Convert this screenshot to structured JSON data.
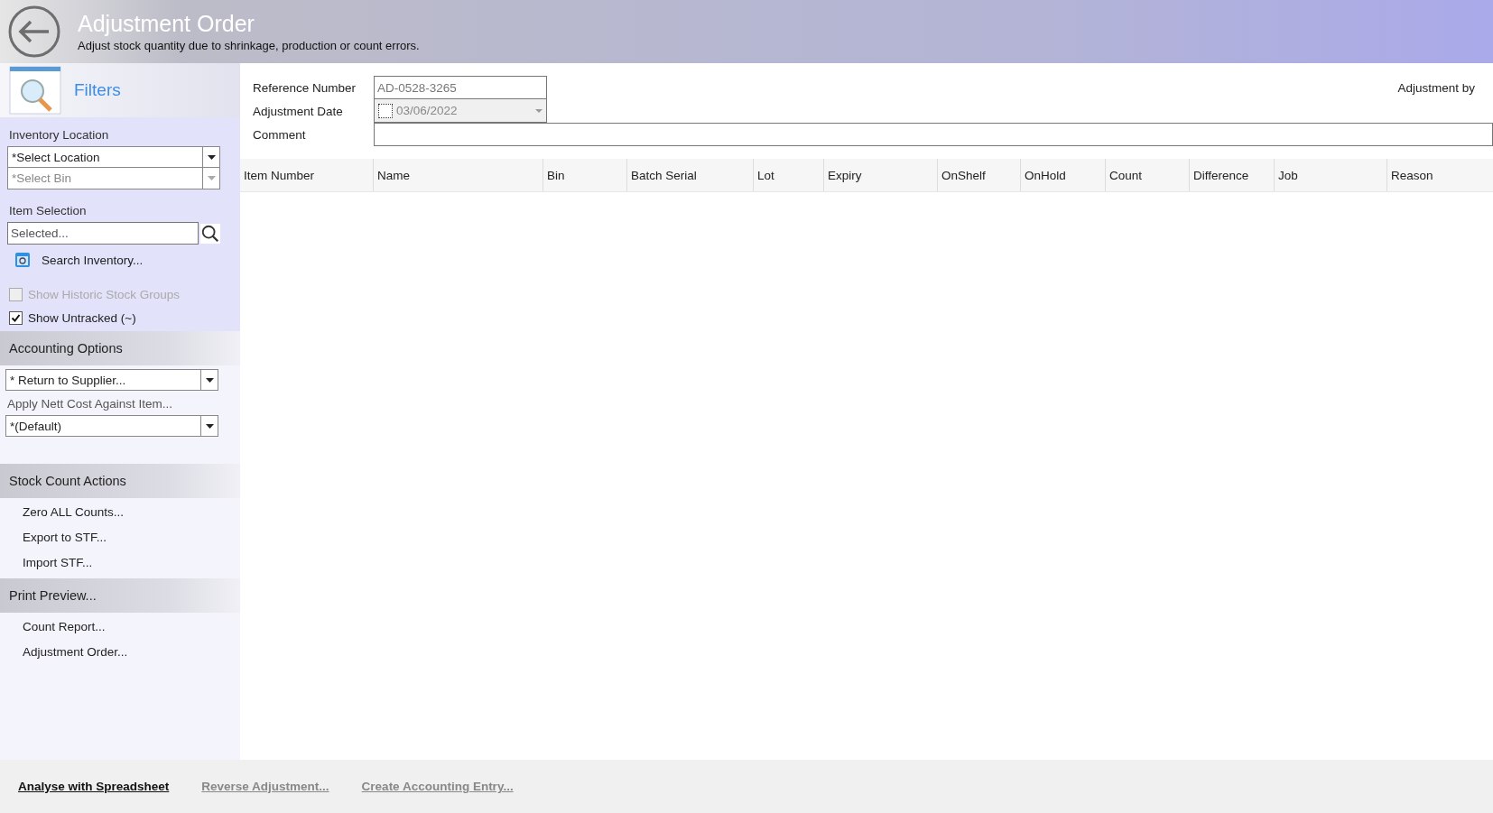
{
  "header": {
    "title": "Adjustment Order",
    "subtitle": "Adjust stock quantity due to shrinkage, production or count errors."
  },
  "sidebar": {
    "filters_title": "Filters",
    "inventory_location": {
      "label": "Inventory Location",
      "location": {
        "value": "*Select Location",
        "disabled": false
      },
      "bin": {
        "value": "*Select Bin",
        "disabled": true
      }
    },
    "item_selection": {
      "label": "Item Selection",
      "placeholder": "Selected...",
      "search_link": "Search Inventory..."
    },
    "options": [
      {
        "label": "Show Historic Stock Groups",
        "checked": false,
        "disabled": true
      },
      {
        "label": "Show Untracked (~)",
        "checked": true,
        "disabled": false
      }
    ],
    "accounting": {
      "title": "Accounting Options",
      "type": "* Return to Supplier...",
      "apply_label": "Apply Nett Cost Against Item...",
      "apply_value": "*(Default)"
    },
    "sections": [
      {
        "title": "Stock Count Actions",
        "items": [
          "Zero ALL Counts...",
          "Export to STF...",
          "Import STF..."
        ]
      },
      {
        "title": "Print Preview...",
        "items": [
          "Count Report...",
          "Adjustment Order..."
        ]
      }
    ]
  },
  "form": {
    "reference_label": "Reference Number",
    "reference_value": "AD-0528-3265",
    "date_label": "Adjustment Date",
    "date_checked": false,
    "date_value": "03/06/2022",
    "comment_label": "Comment",
    "adjustment_by_label": "Adjustment by"
  },
  "table": {
    "columns": [
      "Item Number",
      "Name",
      "Bin",
      "Batch Serial",
      "Lot",
      "Expiry",
      "OnShelf",
      "OnHold",
      "Count",
      "Difference",
      "Job",
      "Reason"
    ]
  },
  "footer": {
    "links": [
      {
        "label": "Analyse with Spreadsheet",
        "disabled": false
      },
      {
        "label": "Reverse Adjustment...",
        "disabled": true
      },
      {
        "label": "Create Accounting Entry...",
        "disabled": true
      }
    ]
  }
}
